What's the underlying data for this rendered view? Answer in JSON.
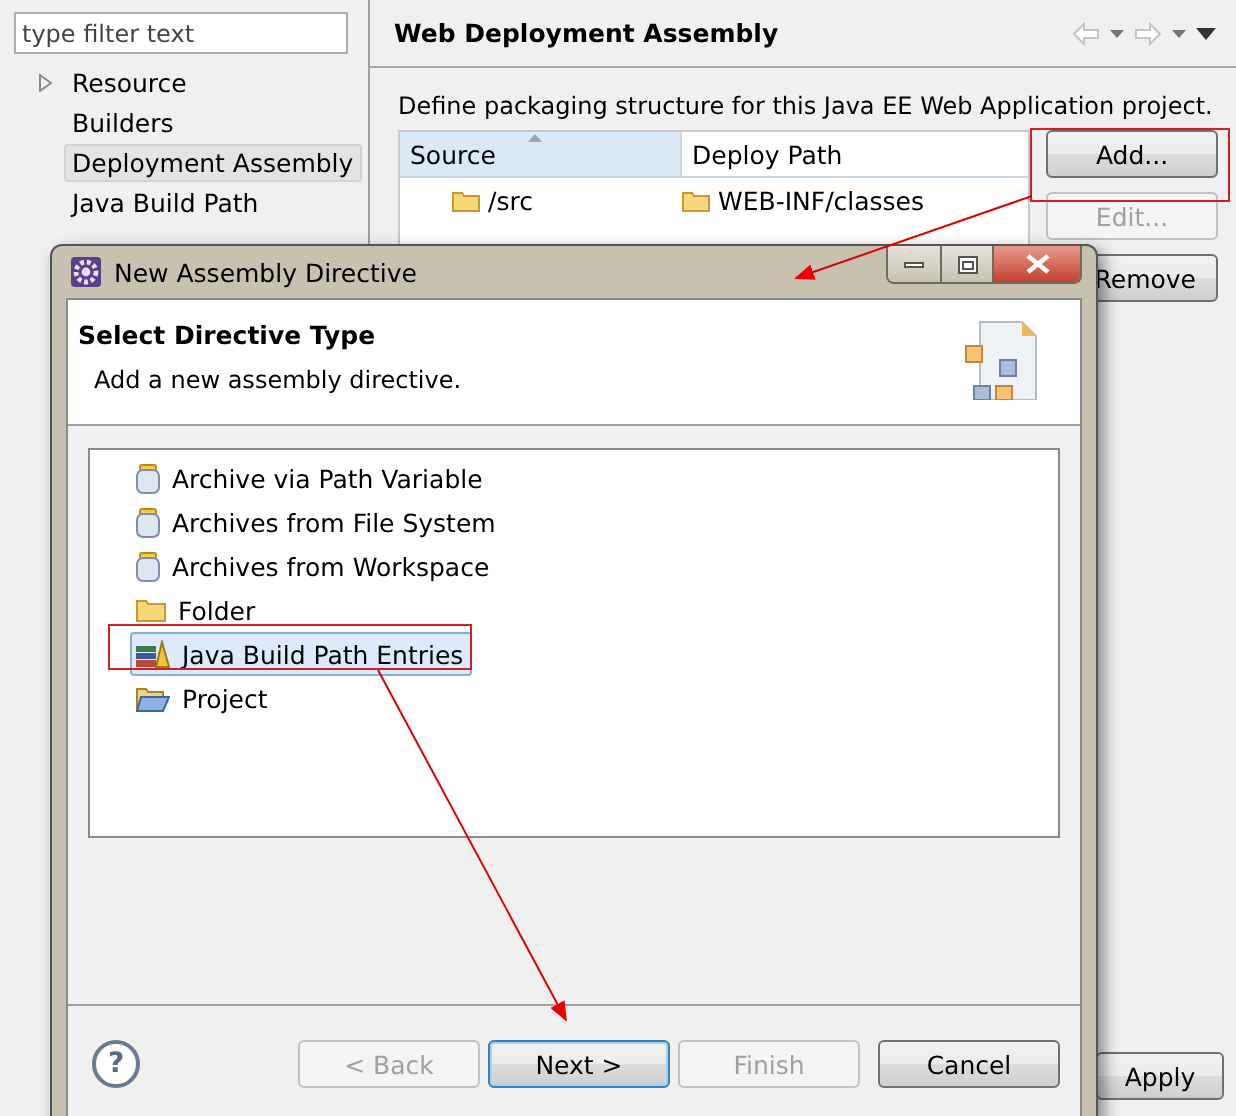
{
  "filter": {
    "placeholder": "type filter text"
  },
  "tree": [
    {
      "label": "Resource",
      "expandable": true,
      "selected": false
    },
    {
      "label": "Builders",
      "expandable": false,
      "selected": false
    },
    {
      "label": "Deployment Assembly",
      "expandable": false,
      "selected": true
    },
    {
      "label": "Java Build Path",
      "expandable": false,
      "selected": false
    }
  ],
  "page": {
    "title": "Web Deployment Assembly",
    "description": "Define packaging structure for this Java EE Web Application project.",
    "columns": [
      "Source",
      "Deploy Path"
    ],
    "rows": [
      {
        "source": "/src",
        "deploy_path": "WEB-INF/classes"
      }
    ],
    "buttons": [
      {
        "label": "Add...",
        "disabled": false
      },
      {
        "label": "Edit...",
        "disabled": true
      },
      {
        "label": "Remove",
        "disabled": false
      }
    ],
    "apply": "Apply"
  },
  "dialog": {
    "title": "New Assembly Directive",
    "heading": "Select Directive Type",
    "subtitle": "Add a new assembly directive.",
    "items": [
      {
        "label": "Archive via Path Variable",
        "kind": "jar",
        "selected": false
      },
      {
        "label": "Archives from File System",
        "kind": "jar",
        "selected": false
      },
      {
        "label": "Archives from Workspace",
        "kind": "jar",
        "selected": false
      },
      {
        "label": "Folder",
        "kind": "folder",
        "selected": false
      },
      {
        "label": "Java Build Path Entries",
        "kind": "library",
        "selected": true
      },
      {
        "label": "Project",
        "kind": "project",
        "selected": false
      }
    ],
    "help": "?",
    "buttons": [
      {
        "label": "< Back",
        "disabled": true,
        "default": false
      },
      {
        "label": "Next >",
        "disabled": false,
        "default": true
      },
      {
        "label": "Finish",
        "disabled": true,
        "default": false
      },
      {
        "label": "Cancel",
        "disabled": false,
        "default": false
      }
    ]
  }
}
